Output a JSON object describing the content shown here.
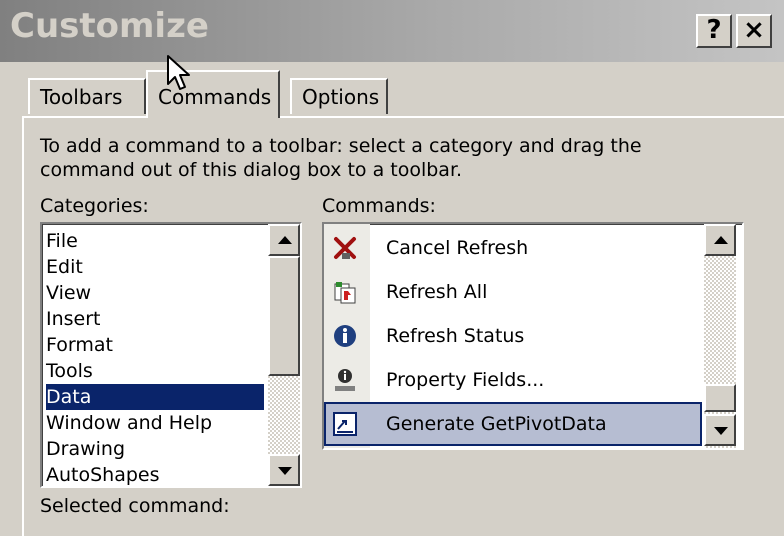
{
  "window": {
    "title": "Customize",
    "help_label": "?",
    "close_label": "×"
  },
  "tabs": [
    {
      "label": "Toolbars"
    },
    {
      "label": "Commands"
    },
    {
      "label": "Options"
    }
  ],
  "instructions": {
    "line1": "To add a command to a toolbar: select a category and drag the",
    "line2": "command out of this dialog box to a toolbar."
  },
  "categories": {
    "label": "Categories:",
    "items": [
      "File",
      "Edit",
      "View",
      "Insert",
      "Format",
      "Tools",
      "Data",
      "Window and Help",
      "Drawing",
      "AutoShapes"
    ],
    "selected": "Data"
  },
  "commands": {
    "label": "Commands:",
    "items": [
      {
        "label": "Cancel Refresh",
        "icon": "cancel-refresh-icon"
      },
      {
        "label": "Refresh All",
        "icon": "refresh-all-icon"
      },
      {
        "label": "Refresh Status",
        "icon": "info-icon"
      },
      {
        "label": "Property Fields...",
        "icon": "property-fields-icon"
      },
      {
        "label": "Generate GetPivotData",
        "icon": "getpivotdata-icon"
      }
    ],
    "selected": "Generate GetPivotData"
  },
  "selected_command": {
    "label": "Selected command:"
  }
}
